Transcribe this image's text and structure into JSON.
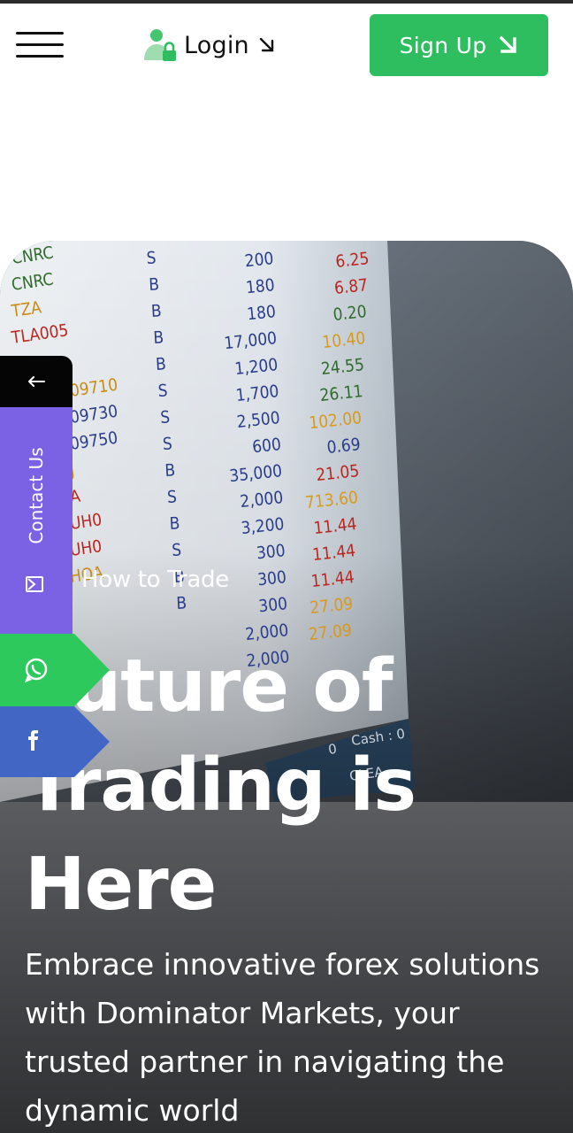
{
  "header": {
    "login_label": "Login",
    "signup_label": "Sign Up",
    "icons": [
      "menu-icon",
      "user-lock-icon",
      "arrow-down-right-icon"
    ],
    "colors": {
      "signup_bg": "#2ebd5f",
      "user_icon": "#46c46f"
    }
  },
  "hero": {
    "kicker": "How to Trade",
    "headline": "Future of Trading is Here",
    "description": "Embrace innovative forex solutions with Dominator Markets, your trusted partner in navigating the dynamic world"
  },
  "background_board": {
    "symbols": [
      "CNRC",
      "CNRC",
      "TZA",
      "TLA005",
      "8",
      "09710",
      "09730",
      "09750",
      "J",
      "A",
      "UH0",
      "UH0",
      "HOA"
    ],
    "sides": [
      "S",
      "B",
      "B",
      "B",
      "B",
      "S",
      "S",
      "S",
      "B",
      "S",
      "B",
      "S",
      "B",
      "B"
    ],
    "quantities": [
      "200",
      "180",
      "180",
      "17,000",
      "1,200",
      "1,700",
      "2,500",
      "600",
      "35,000",
      "2,000",
      "3,200",
      "300",
      "300",
      "300",
      "2,000",
      "2,000"
    ],
    "prices": [
      "6.25",
      "6.87",
      "0.20",
      "10.40",
      "24.55",
      "26.11",
      "102.00",
      "0.69",
      "21.05",
      "713.60",
      "11.44",
      "11.44",
      "11.44",
      "27.09",
      "27.09"
    ],
    "footer_text": [
      "0",
      "Cash : 0",
      "CLEA"
    ]
  },
  "sidebar": {
    "toggle_icon": "arrow-left-icon",
    "contact_label": "Contact Us",
    "colors": {
      "toggle": "#050505",
      "contact": "#7b61e3",
      "whatsapp": "#2ec95c",
      "facebook": "#4266c4"
    }
  }
}
